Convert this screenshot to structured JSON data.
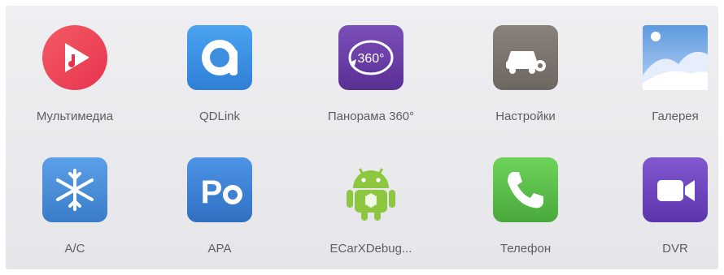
{
  "apps_row1": [
    {
      "label": "Мультимедиа",
      "icon": "multimedia-icon"
    },
    {
      "label": "QDLink",
      "icon": "qdlink-icon"
    },
    {
      "label": "Панорама 360°",
      "icon": "panorama-360-icon",
      "badge": "360°"
    },
    {
      "label": "Настройки",
      "icon": "settings-car-icon"
    },
    {
      "label": "Галерея",
      "icon": "gallery-icon"
    }
  ],
  "apps_row2": [
    {
      "label": "A/C",
      "icon": "snowflake-icon"
    },
    {
      "label": "APA",
      "icon": "parking-assist-icon"
    },
    {
      "label": "ECarXDebug...",
      "icon": "android-icon"
    },
    {
      "label": "Телефон",
      "icon": "phone-icon"
    },
    {
      "label": "DVR",
      "icon": "video-camera-icon"
    }
  ],
  "colors": {
    "multimedia": "#ef4056",
    "qdlink": "#3f8fe0",
    "panorama": "#6b3fa8",
    "settings": "#7d746e",
    "gallery": "#6fa2dc",
    "ac": "#4b8fd6",
    "apa": "#3f7fd0",
    "android": "#8dc63f",
    "phone": "#5ec04d",
    "dvr": "#7147c0"
  }
}
